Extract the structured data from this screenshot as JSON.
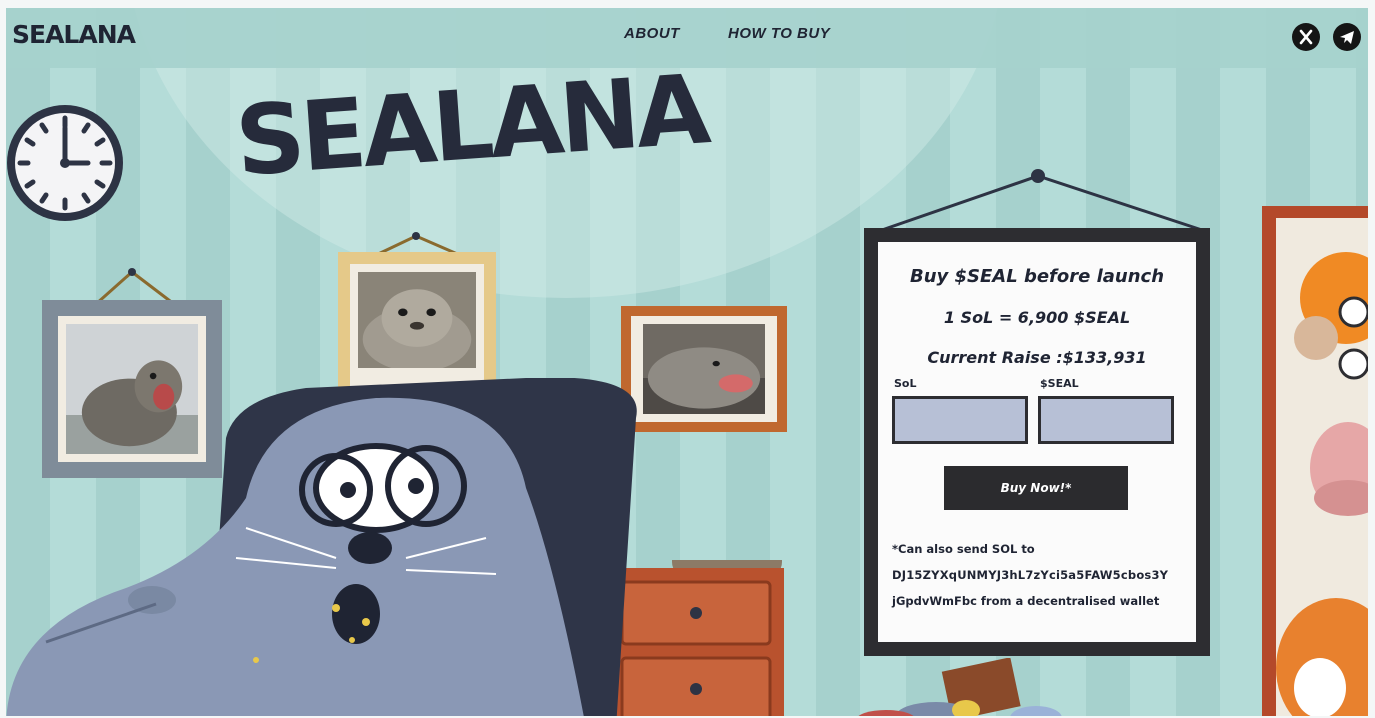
{
  "nav": {
    "brand": "SEALANA",
    "links": [
      "ABOUT",
      "HOW TO BUY"
    ],
    "social": [
      {
        "icon": "x-logo-icon",
        "color": "#151515"
      },
      {
        "icon": "telegram-icon",
        "color": "#151515"
      }
    ]
  },
  "hero": {
    "title": "SEALANA"
  },
  "presale": {
    "headline": "Buy $SEAL before launch",
    "rate": "1 SoL = 6,900 $SEAL",
    "raise": "Current Raise :$133,931",
    "sol_label": "SoL",
    "seal_label": "$SEAL",
    "sol_value": "",
    "seal_value": "",
    "button": "Buy Now!*",
    "note_lines": [
      "*Can also send SOL to",
      "DJ15ZYXqUNMYJ3hL7zYci5a5FAW5cbos3Y",
      "jGpdvWmFbc from a decentralised wallet"
    ]
  },
  "colors": {
    "wall": "#a6d1cd",
    "ink": "#1f2433",
    "input": "#b7c0d6",
    "button": "#2b2b2e",
    "seal": "#8a98b5"
  },
  "art": {
    "icons": [
      "clock-icon",
      "framed-seal-photo",
      "seal-character",
      "dresser",
      "door"
    ]
  }
}
